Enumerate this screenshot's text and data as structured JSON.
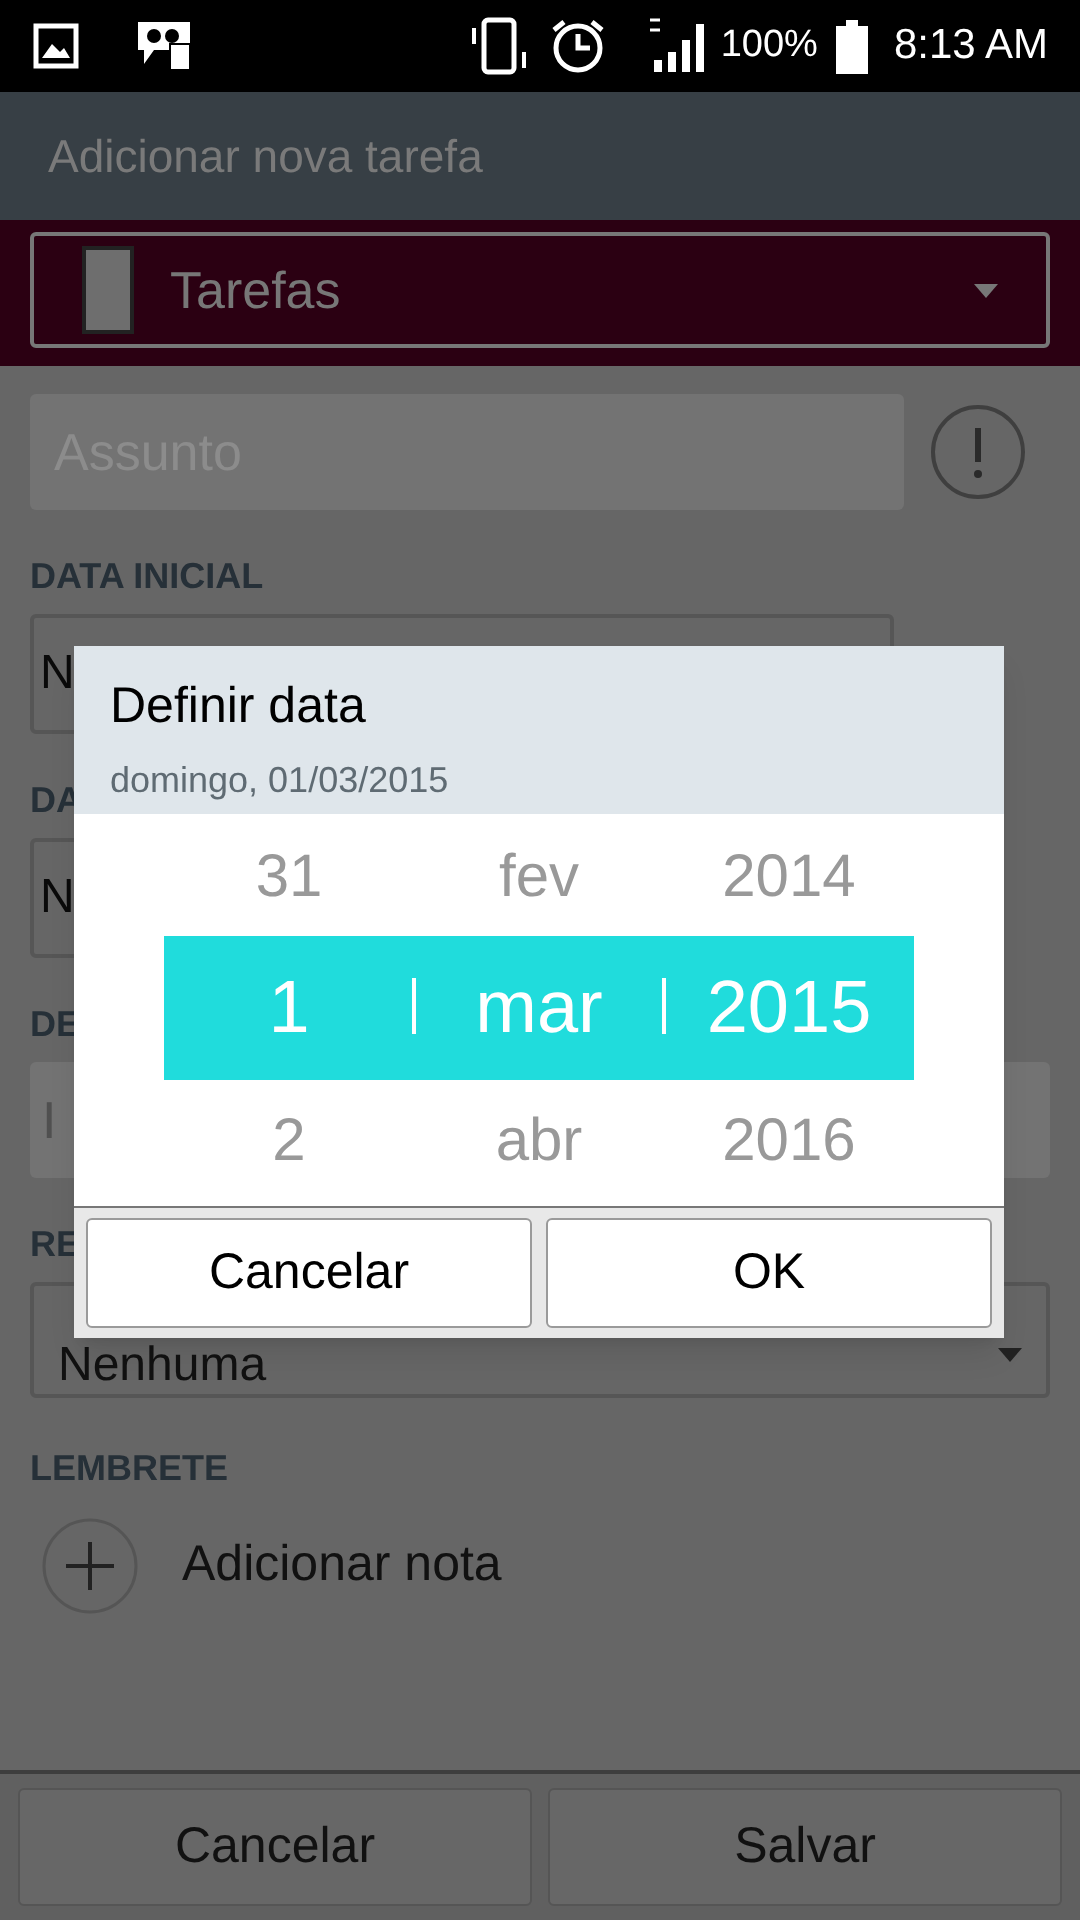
{
  "status_bar": {
    "battery": "100%",
    "time": "8:13 AM"
  },
  "header": {
    "title": "Adicionar nova tarefa"
  },
  "calendar_select": {
    "value": "Tarefas"
  },
  "subject": {
    "placeholder": "Assunto"
  },
  "sections": [
    {
      "label": "DATA INICIAL",
      "value": "N",
      "kind": "field"
    },
    {
      "label": "DA",
      "value": "N",
      "kind": "field"
    },
    {
      "label": "DE",
      "placeholder": "I",
      "kind": "input"
    },
    {
      "label": "RE",
      "value": "Nenhuma",
      "kind": "dropdown"
    }
  ],
  "reminder": {
    "label": "LEMBRETE",
    "action": "Adicionar nota"
  },
  "buttons": [
    "Cancelar",
    "Salvar"
  ],
  "dialog": {
    "title": "Definir data",
    "subtitle": "domingo, 01/03/2015",
    "columns": [
      {
        "items": [
          {
            "text": "31",
            "selected": false
          },
          {
            "text": "1",
            "selected": true
          },
          {
            "text": "2",
            "selected": false
          }
        ]
      },
      {
        "items": [
          {
            "text": "fev",
            "selected": false
          },
          {
            "text": "mar",
            "selected": true
          },
          {
            "text": "abr",
            "selected": false
          }
        ]
      },
      {
        "items": [
          {
            "text": "2014",
            "selected": false
          },
          {
            "text": "2015",
            "selected": true
          },
          {
            "text": "2016",
            "selected": false
          }
        ]
      }
    ],
    "buttons": [
      "Cancelar",
      "OK"
    ]
  }
}
